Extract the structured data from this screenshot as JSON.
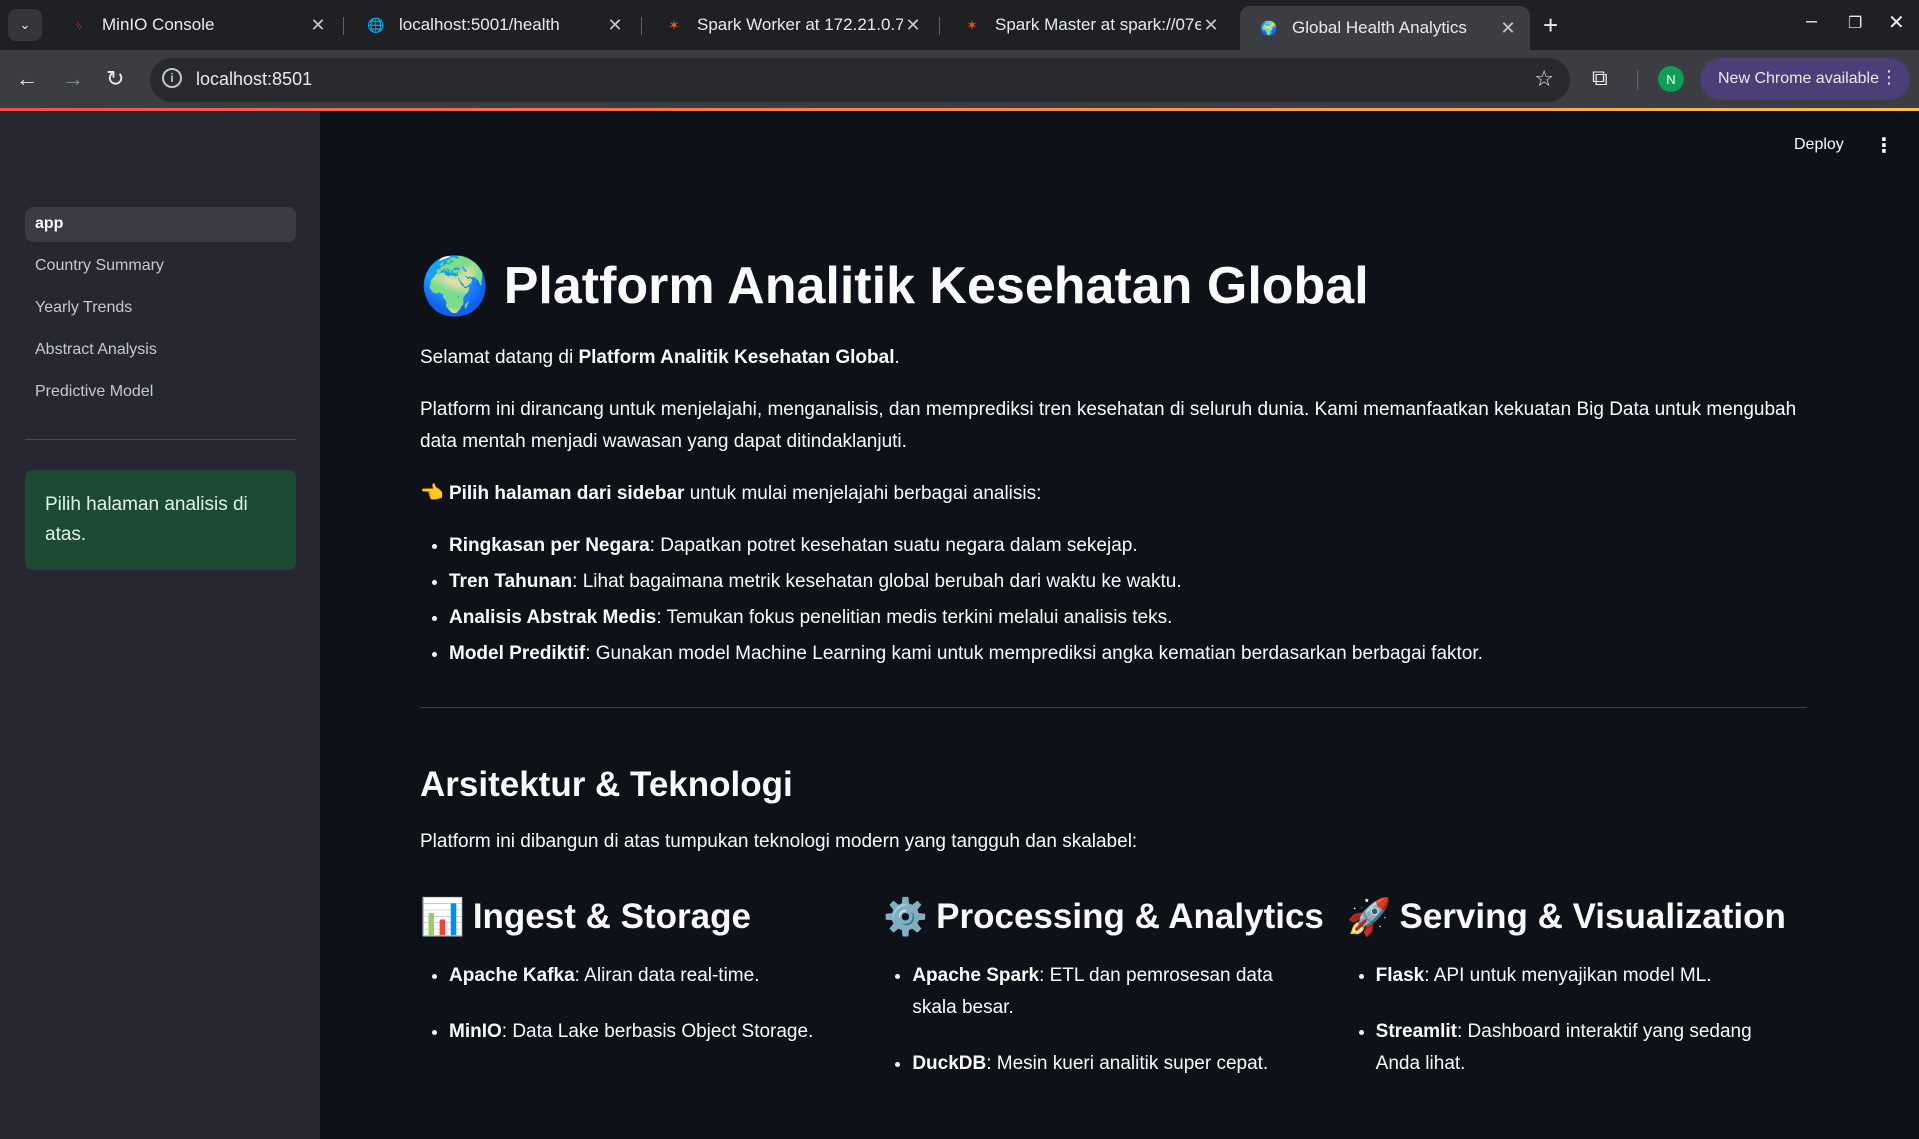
{
  "browser": {
    "tabs": [
      {
        "title": "MinIO Console",
        "favicon": "minio-icon"
      },
      {
        "title": "localhost:5001/health",
        "favicon": "globe-icon"
      },
      {
        "title": "Spark Worker at 172.21.0.7:",
        "favicon": "spark-icon"
      },
      {
        "title": "Spark Master at spark://07e",
        "favicon": "spark-icon"
      },
      {
        "title": "Global Health Analytics",
        "favicon": "earth-icon",
        "active": true
      }
    ],
    "url": "localhost:8501",
    "profile_initial": "N",
    "update_label": "New Chrome available"
  },
  "sidebar": {
    "items": [
      {
        "label": "app",
        "active": true
      },
      {
        "label": "Country Summary"
      },
      {
        "label": "Yearly Trends"
      },
      {
        "label": "Abstract Analysis"
      },
      {
        "label": "Predictive Model"
      }
    ],
    "info": "Pilih halaman analisis di atas."
  },
  "header": {
    "deploy": "Deploy"
  },
  "main": {
    "title_emoji": "🌍",
    "title": "Platform Analitik Kesehatan Global",
    "welcome_prefix": "Selamat datang di ",
    "welcome_bold": "Platform Analitik Kesehatan Global",
    "welcome_suffix": ".",
    "intro": "Platform ini dirancang untuk menjelajahi, menganalisis, dan memprediksi tren kesehatan di seluruh dunia. Kami memanfaatkan kekuatan Big Data untuk mengubah data mentah menjadi wawasan yang dapat ditindaklanjuti.",
    "pick_emoji": "👈",
    "pick_bold": "Pilih halaman dari sidebar",
    "pick_rest": " untuk mulai menjelajahi berbagai analisis:",
    "features": [
      {
        "bold": "Ringkasan per Negara",
        "text": ": Dapatkan potret kesehatan suatu negara dalam sekejap."
      },
      {
        "bold": "Tren Tahunan",
        "text": ": Lihat bagaimana metrik kesehatan global berubah dari waktu ke waktu."
      },
      {
        "bold": "Analisis Abstrak Medis",
        "text": ": Temukan fokus penelitian medis terkini melalui analisis teks."
      },
      {
        "bold": "Model Prediktif",
        "text": ": Gunakan model Machine Learning kami untuk memprediksi angka kematian berdasarkan berbagai faktor."
      }
    ],
    "arch_title": "Arsitektur & Teknologi",
    "arch_intro": "Platform ini dibangun di atas tumpukan teknologi modern yang tangguh dan skalabel:",
    "columns": [
      {
        "emoji": "📊",
        "title": "Ingest & Storage",
        "items": [
          {
            "bold": "Apache Kafka",
            "text": ": Aliran data real-time."
          },
          {
            "bold": "MinIO",
            "text": ": Data Lake berbasis Object Storage."
          }
        ]
      },
      {
        "emoji": "⚙️",
        "title": "Processing & Analytics",
        "items": [
          {
            "bold": "Apache Spark",
            "text": ": ETL dan pemrosesan data skala besar."
          },
          {
            "bold": "DuckDB",
            "text": ": Mesin kueri analitik super cepat."
          }
        ]
      },
      {
        "emoji": "🚀",
        "title": "Serving & Visualization",
        "items": [
          {
            "bold": "Flask",
            "text": ": API untuk menyajikan model ML."
          },
          {
            "bold": "Streamlit",
            "text": ": Dashboard interaktif yang sedang Anda lihat."
          }
        ]
      }
    ]
  }
}
